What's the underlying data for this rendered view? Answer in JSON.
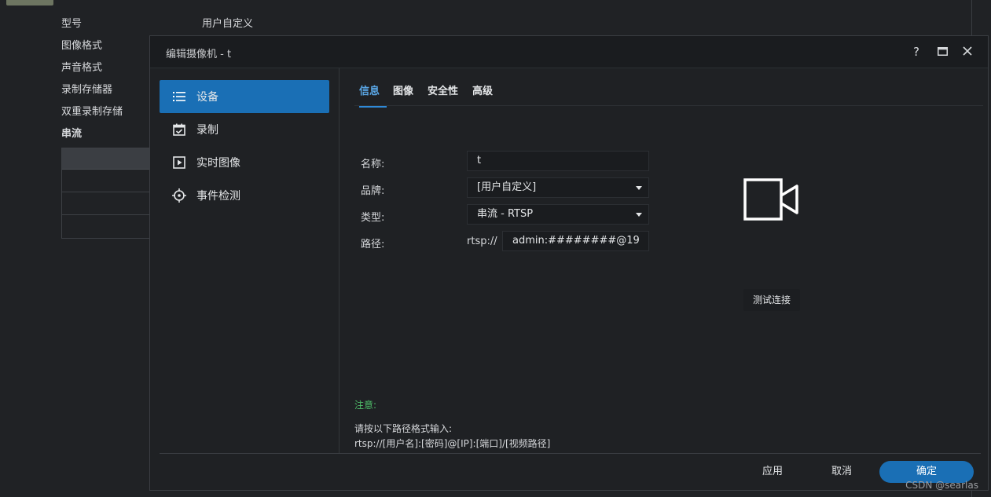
{
  "background": {
    "rows": [
      {
        "label": "型号",
        "value": "用户自定义"
      },
      {
        "label": "图像格式"
      },
      {
        "label": "声音格式"
      },
      {
        "label": "录制存储器"
      },
      {
        "label": "双重录制存储"
      },
      {
        "label": "串流"
      }
    ]
  },
  "dialog": {
    "title": "编辑摄像机 - t",
    "help_icon": "?",
    "maximize_icon": "□",
    "close_icon": "×"
  },
  "sidebar": {
    "items": [
      {
        "label": "设备",
        "icon": "list-icon",
        "active": true
      },
      {
        "label": "录制",
        "icon": "calendar-check-icon"
      },
      {
        "label": "实时图像",
        "icon": "play-square-icon"
      },
      {
        "label": "事件检测",
        "icon": "crosshair-icon"
      }
    ]
  },
  "tabs": [
    {
      "label": "信息",
      "active": true
    },
    {
      "label": "图像"
    },
    {
      "label": "安全性"
    },
    {
      "label": "高级"
    }
  ],
  "form": {
    "name_label": "名称:",
    "name_value": "t",
    "brand_label": "品牌:",
    "brand_value": "[用户自定义]",
    "type_label": "类型:",
    "type_value": "串流 - RTSP",
    "path_label": "路径:",
    "path_prefix": "rtsp://",
    "path_value": "admin:########@19"
  },
  "preview": {
    "icon": "video-camera-icon",
    "test_button": "测试连接"
  },
  "note": {
    "title": "注意:",
    "line1": "请按以下路径格式输入:",
    "line2": "rtsp://[用户名]:[密码]@[IP]:[端口]/[视频路径]"
  },
  "footer": {
    "apply": "应用",
    "cancel": "取消",
    "ok": "确定"
  },
  "watermark": "CSDN @searlas",
  "colors": {
    "accent": "#1a6fb5",
    "tab_active": "#5aa7e6",
    "note": "#4fbf6a",
    "background": "#202225"
  }
}
